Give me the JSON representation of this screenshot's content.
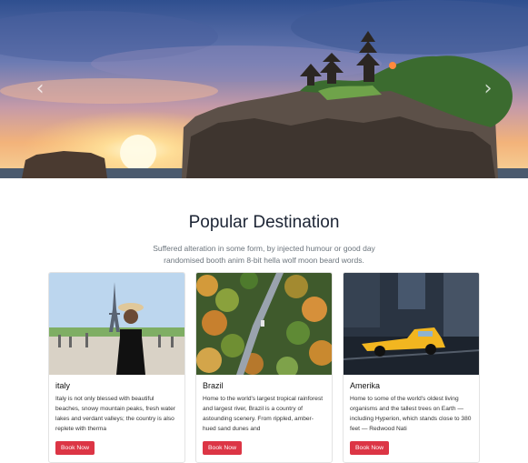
{
  "hero": {
    "prev_icon": "chevron-left-icon",
    "next_icon": "chevron-right-icon",
    "prev_glyph": "‹",
    "next_glyph": "›"
  },
  "section": {
    "title": "Popular Destination",
    "subtitle": "Suffered alteration in some form, by injected humour or good day randomised booth anim 8-bit hella wolf moon beard words."
  },
  "cards": [
    {
      "title": "italy",
      "text": "Italy is not only blessed with beautiful beaches, snowy mountain peaks, fresh water lakes and verdant valleys; the country is also replete with therma",
      "button": "Book Now"
    },
    {
      "title": "Brazil",
      "text": "Home to the world's largest tropical rainforest and largest river, Brazil is a country of astounding scenery. From rippled, amber-hued sand dunes and",
      "button": "Book Now"
    },
    {
      "title": "Amerika",
      "text": "Home to some of the world's oldest living organisms and the tallest trees on Earth — including Hyperion, which stands close to 380 feet — Redwood Nati",
      "button": "Book Now"
    }
  ],
  "colors": {
    "button": "#dc3545",
    "title": "#1c2434"
  }
}
